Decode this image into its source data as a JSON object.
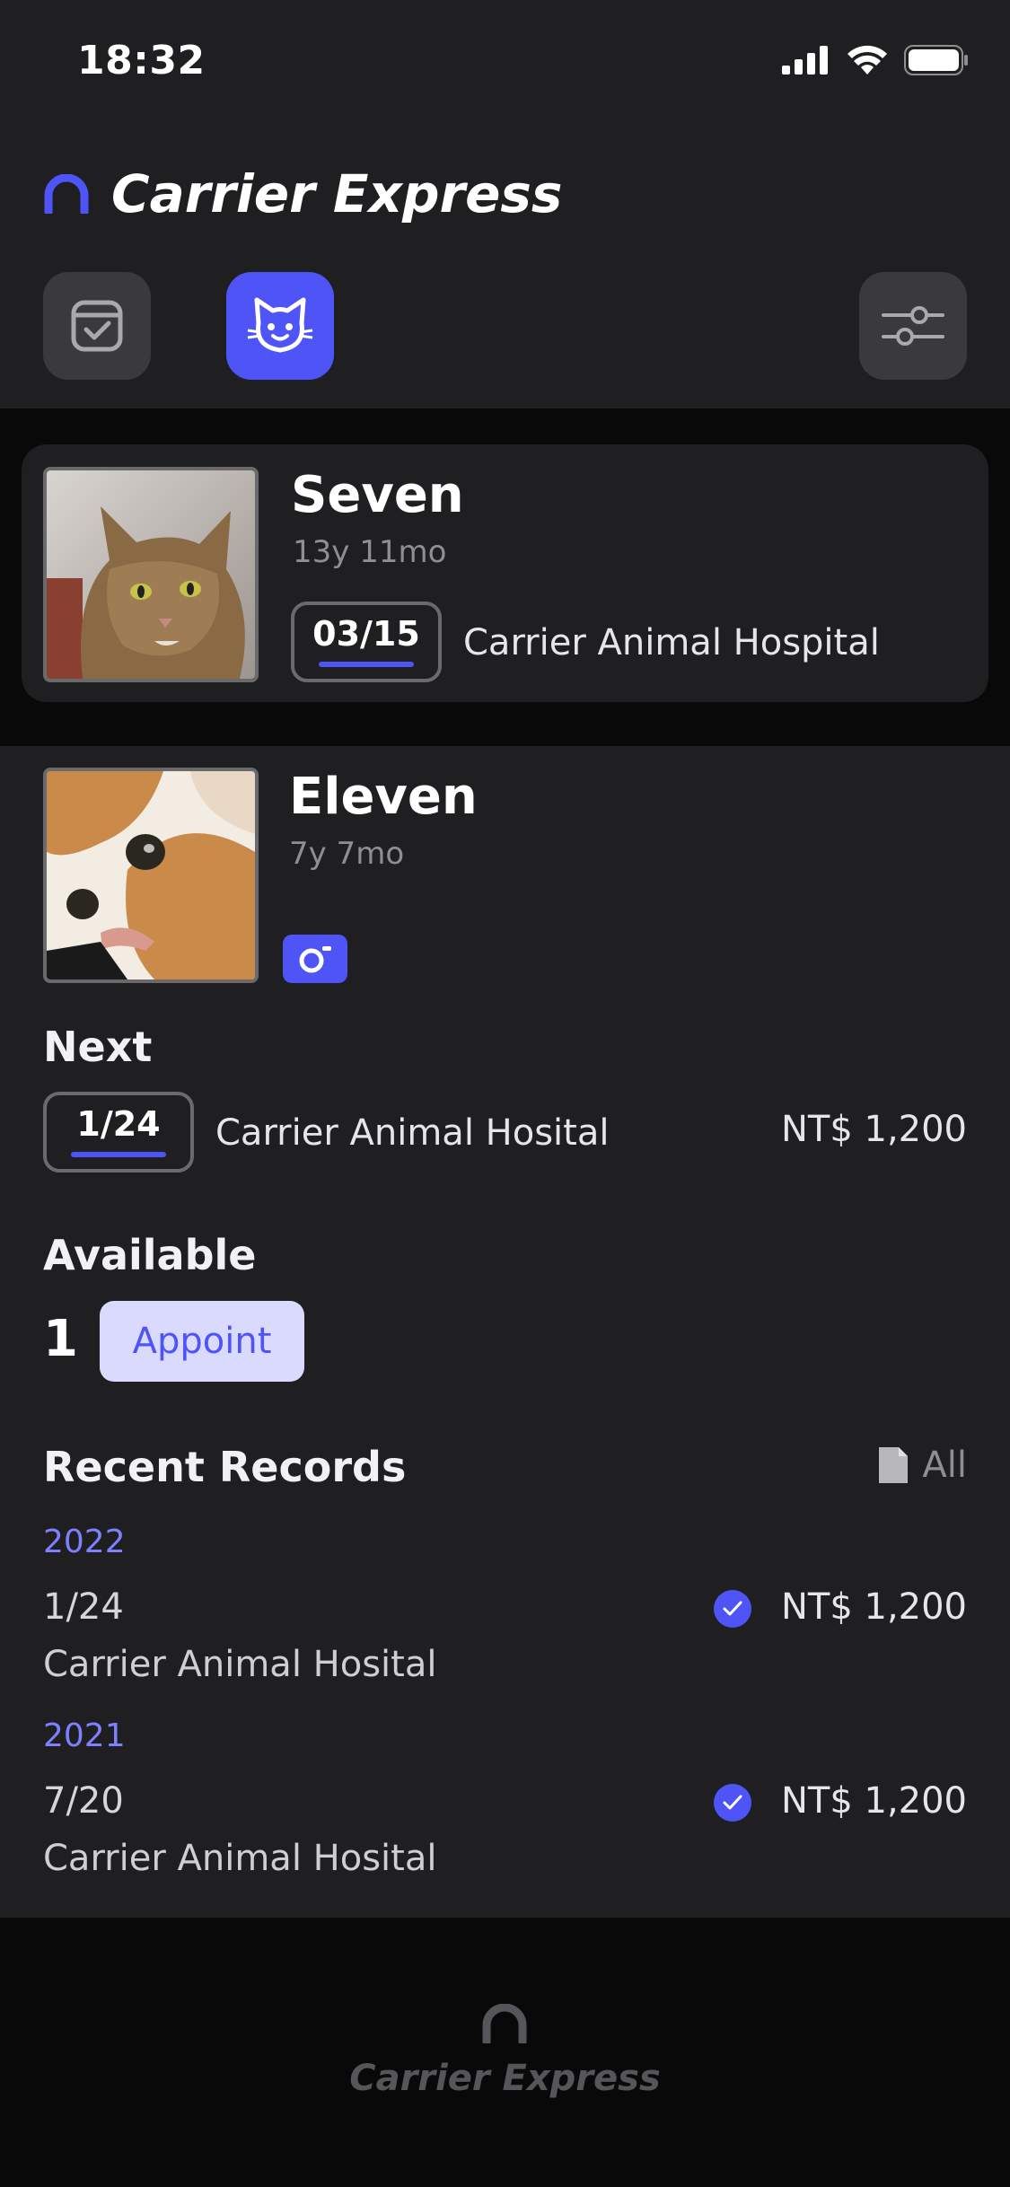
{
  "status_bar": {
    "time": "18:32"
  },
  "app": {
    "title": "Carrier Express"
  },
  "pets": [
    {
      "name": "Seven",
      "age": "13y 11mo",
      "next_date": "03/15",
      "hospital": "Carrier Animal Hospital"
    },
    {
      "name": "Eleven",
      "age": "7y 7mo"
    }
  ],
  "next": {
    "title": "Next",
    "date": "1/24",
    "place": "Carrier Animal Hosital",
    "price": "NT$ 1,200"
  },
  "available": {
    "title": "Available",
    "count": "1",
    "button": "Appoint"
  },
  "records": {
    "title": "Recent Records",
    "all_label": "All",
    "groups": [
      {
        "year": "2022",
        "date": "1/24",
        "place": "Carrier Animal Hosital",
        "price": "NT$ 1,200"
      },
      {
        "year": "2021",
        "date": "7/20",
        "place": "Carrier Animal Hosital",
        "price": "NT$ 1,200"
      }
    ]
  },
  "footer": {
    "title": "Carrier Express"
  },
  "colors": {
    "accent": "#4f54f6",
    "background": "#1f1f21",
    "appoint_bg": "#d9dafd"
  },
  "icons": [
    "signal-icon",
    "wifi-icon",
    "battery-icon",
    "logo-arch-icon",
    "calendar-check-icon",
    "cat-icon",
    "sliders-icon",
    "camera-icon",
    "document-icon",
    "check-circle-icon"
  ]
}
